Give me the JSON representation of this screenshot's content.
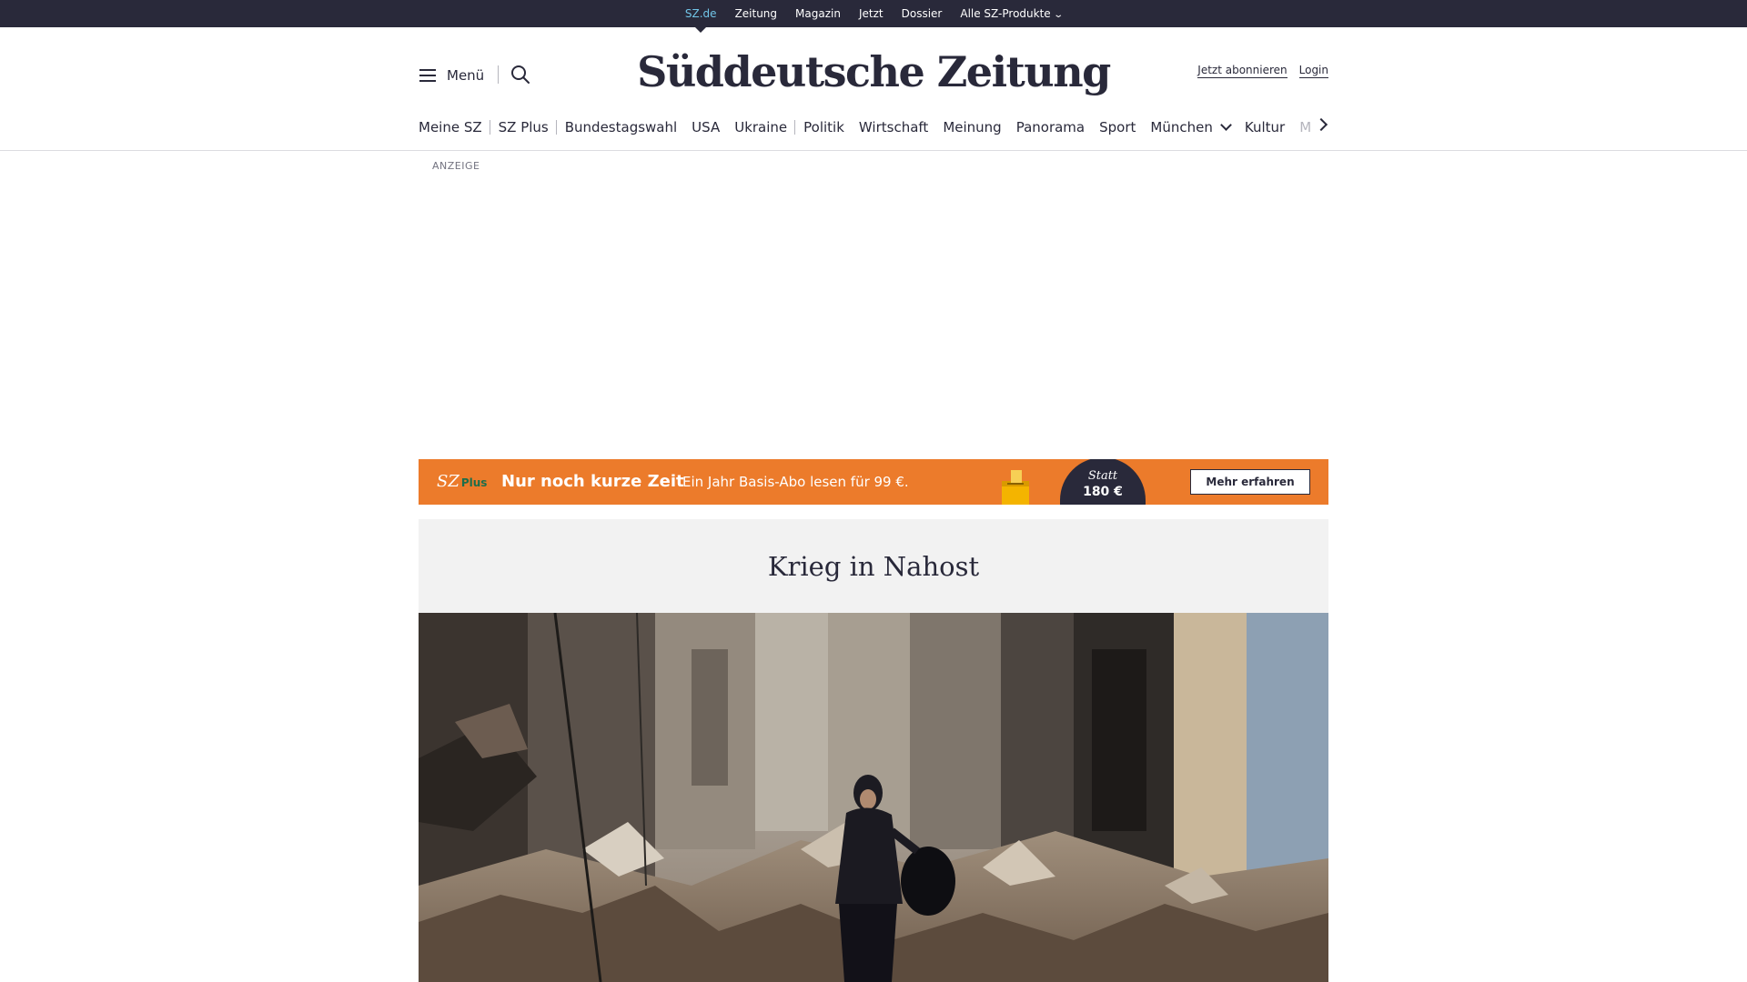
{
  "topbar": {
    "links": [
      "SZ.de",
      "Zeitung",
      "Magazin",
      "Jetzt",
      "Dossier",
      "Alle SZ-Produkte"
    ],
    "active": "SZ.de"
  },
  "header": {
    "menu_label": "Menü",
    "logo": "Süddeutsche Zeitung",
    "subscribe_label": "Jetzt abonnieren",
    "login_label": "Login"
  },
  "nav": {
    "items": [
      "Meine SZ",
      "SZ Plus",
      "Bundestagswahl",
      "USA",
      "Ukraine",
      "Politik",
      "Wirtschaft",
      "Meinung",
      "Panorama",
      "Sport",
      "München",
      "Kultur",
      "M"
    ]
  },
  "ad": {
    "label": "ANZEIGE"
  },
  "promo": {
    "logo_sz": "SZ",
    "logo_plus": "Plus",
    "headline": "Nur noch kurze Zeit",
    "subline": "Ein Jahr Basis-Abo lesen für 99 €.",
    "price_prefix": "Statt",
    "price": "180 €",
    "button_label": "Mehr erfahren"
  },
  "section": {
    "title": "Krieg in Nahost"
  },
  "colors": {
    "topbar_bg": "#29293a",
    "active_link": "#71c5e8",
    "promo_bg": "#ec7b2b",
    "section_bg": "#f2f2f2"
  },
  "icons": [
    "hamburger-icon",
    "search-icon",
    "chevron-down-icon",
    "chevron-right-icon",
    "ballot-box-icon"
  ]
}
